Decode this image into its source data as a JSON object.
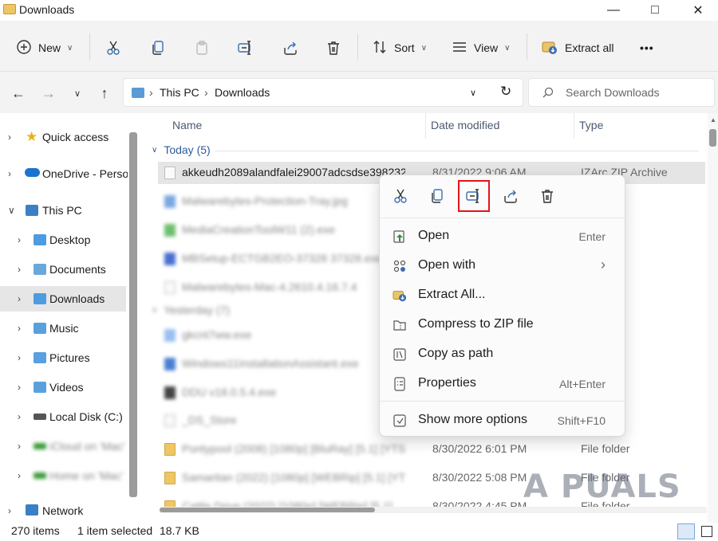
{
  "window": {
    "title": "Downloads"
  },
  "toolbar": {
    "new_label": "New",
    "sort_label": "Sort",
    "view_label": "View",
    "extract_label": "Extract all",
    "more_label": "•••"
  },
  "address": {
    "crumbs": [
      "This PC",
      "Downloads"
    ],
    "search_placeholder": "Search Downloads"
  },
  "nav": {
    "items": [
      {
        "label": "Quick access",
        "icon": "star-icon"
      },
      {
        "label": "OneDrive - Perso",
        "icon": "cloud-icon"
      },
      {
        "label": "This PC",
        "icon": "pc-icon"
      },
      {
        "label": "Desktop",
        "icon": "folder-icon"
      },
      {
        "label": "Documents",
        "icon": "folder-icon"
      },
      {
        "label": "Downloads",
        "icon": "folder-icon"
      },
      {
        "label": "Music",
        "icon": "folder-icon"
      },
      {
        "label": "Pictures",
        "icon": "folder-icon"
      },
      {
        "label": "Videos",
        "icon": "folder-icon"
      },
      {
        "label": "Local Disk (C:)",
        "icon": "disk-icon"
      },
      {
        "label": "iCloud on 'Mac'",
        "icon": "net-drive-icon"
      },
      {
        "label": "Home on 'Mac'",
        "icon": "net-drive-icon"
      },
      {
        "label": "Network",
        "icon": "network-icon"
      }
    ]
  },
  "columns": {
    "name": "Name",
    "date": "Date modified",
    "type": "Type"
  },
  "groups": {
    "today": "Today (5)",
    "yesterday": "Yesterday (7)"
  },
  "files": [
    {
      "name": "akkeudh2089alandfalei29007adcsdse398232a",
      "date": "8/31/2022 9:06 AM",
      "type": "IZArc ZIP Archive"
    },
    {
      "name": "Malwarebytes-Protection-Tray.jpg",
      "date": "",
      "type": ""
    },
    {
      "name": "MediaCreationToolW11 (2).exe",
      "date": "",
      "type": "on"
    },
    {
      "name": "MBSetup-ECTGB2EO-37328 37328.exe",
      "date": "",
      "type": "on"
    },
    {
      "name": "Malwarebytes-Mac-4.2610.4.16.7.4",
      "date": "",
      "type": ""
    },
    {
      "name": "gkcnt7ww.exe",
      "date": "",
      "type": "on"
    },
    {
      "name": "Windows11InstallationAssistant.exe",
      "date": "",
      "type": "on"
    },
    {
      "name": "DDU v18.0.5.4.exe",
      "date": "",
      "type": "on"
    },
    {
      "name": "_DS_Store",
      "date": "",
      "type": "RE File"
    },
    {
      "name": "Pontypool (2008) [1080p] [BluRay] [5.1] [YTS",
      "date": "8/30/2022 6:01 PM",
      "type": "File folder"
    },
    {
      "name": "Samaritan (2022) [1080p] [WEBRip] [5.1] [YTS",
      "date": "8/30/2022 5:08 PM",
      "type": "File folder"
    },
    {
      "name": "Cattle Drive (2022) [1080p] [WEBRip] [5.1]",
      "date": "8/30/2022 4:45 PM",
      "type": "File folder"
    }
  ],
  "context_menu": {
    "top_icons": [
      "cut-icon",
      "copy-icon",
      "rename-icon",
      "share-icon",
      "delete-icon"
    ],
    "items": [
      {
        "label": "Open",
        "shortcut": "Enter"
      },
      {
        "label": "Open with",
        "shortcut": "›"
      },
      {
        "label": "Extract All...",
        "shortcut": ""
      },
      {
        "label": "Compress to ZIP file",
        "shortcut": ""
      },
      {
        "label": "Copy as path",
        "shortcut": ""
      },
      {
        "label": "Properties",
        "shortcut": "Alt+Enter"
      },
      {
        "label": "Show more options",
        "shortcut": "Shift+F10"
      }
    ]
  },
  "status": {
    "items": "270 items",
    "selected": "1 item selected",
    "size": "18.7 KB"
  },
  "watermark": "A  PUALS",
  "colors": {
    "folder": "#eec666",
    "accent": "#2e5d9b",
    "highlight": "#e3131b"
  }
}
